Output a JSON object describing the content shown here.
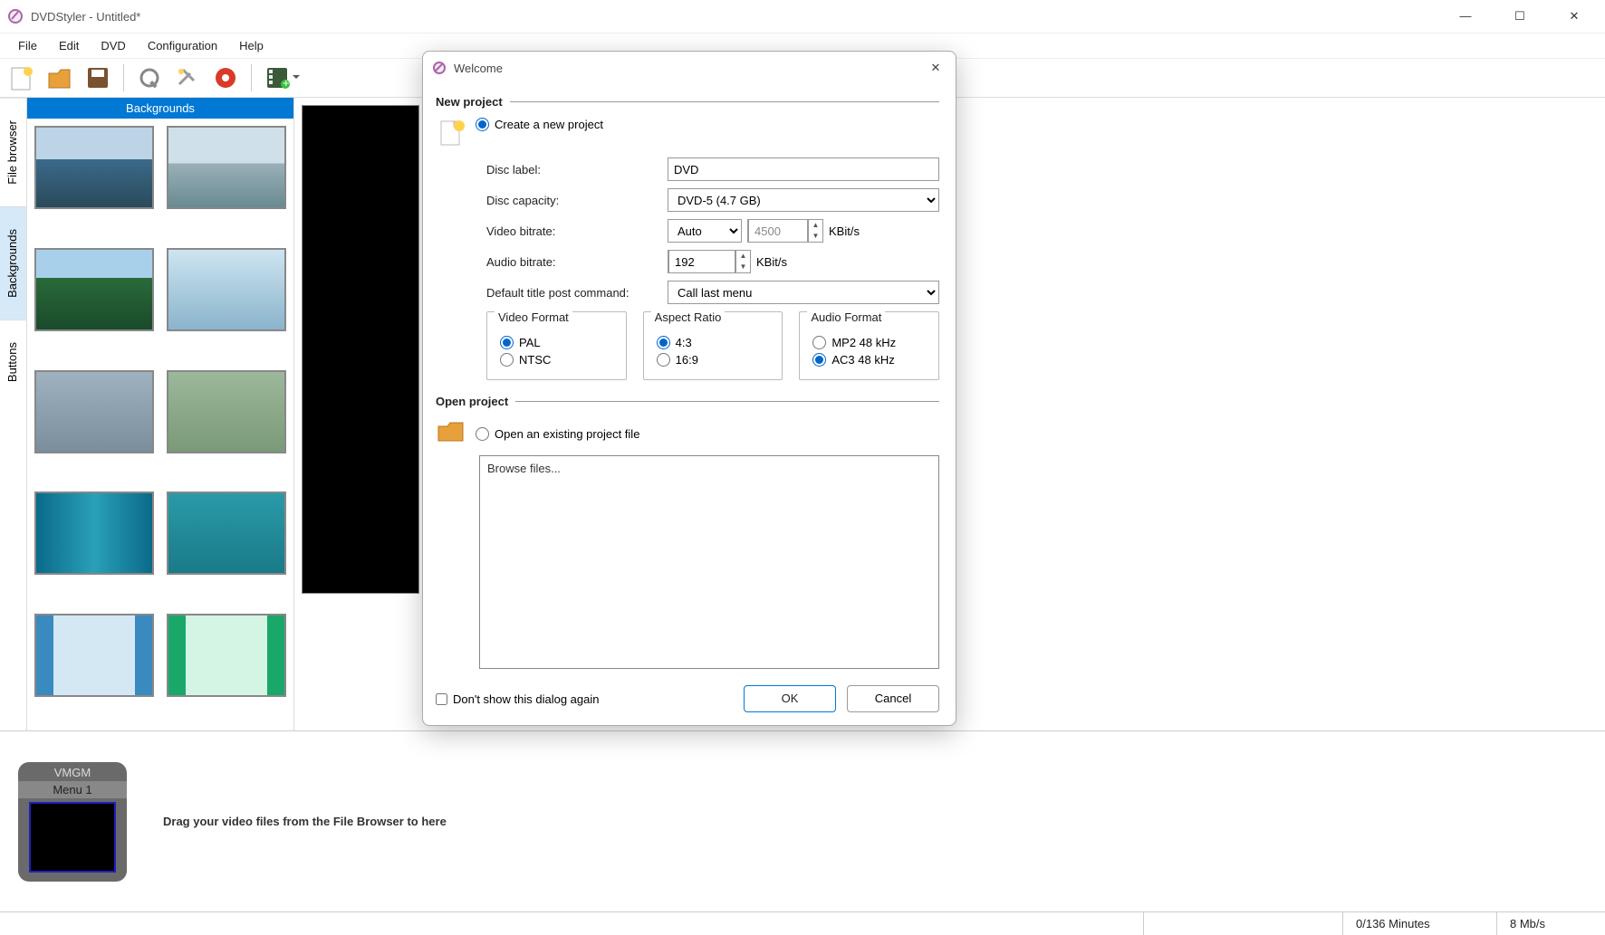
{
  "window": {
    "title": "DVDStyler - Untitled*"
  },
  "menu": {
    "items": [
      "File",
      "Edit",
      "DVD",
      "Configuration",
      "Help"
    ]
  },
  "sidebar": {
    "tabs": [
      "File browser",
      "Backgrounds",
      "Buttons"
    ],
    "active": 1
  },
  "panel": {
    "header": "Backgrounds"
  },
  "timeline": {
    "vmgm_label": "VMGM",
    "menu_label": "Menu 1",
    "hint": "Drag your video files from the File Browser to here"
  },
  "statusbar": {
    "minutes": "0/136 Minutes",
    "bitrate": "8 Mb/s"
  },
  "dialog": {
    "title": "Welcome",
    "new_project_heading": "New project",
    "create_label": "Create a new project",
    "disc_label_lab": "Disc label:",
    "disc_label_val": "DVD",
    "disc_capacity_lab": "Disc capacity:",
    "disc_capacity_val": "DVD-5 (4.7 GB)",
    "video_bitrate_lab": "Video bitrate:",
    "video_bitrate_mode": "Auto",
    "video_bitrate_val": "4500",
    "audio_bitrate_lab": "Audio bitrate:",
    "audio_bitrate_val": "192",
    "kbits": "KBit/s",
    "post_cmd_lab": "Default title post command:",
    "post_cmd_val": "Call last menu",
    "video_format_legend": "Video Format",
    "vf_pal": "PAL",
    "vf_ntsc": "NTSC",
    "aspect_legend": "Aspect Ratio",
    "ar_43": "4:3",
    "ar_169": "16:9",
    "audio_format_legend": "Audio Format",
    "af_mp2": "MP2 48 kHz",
    "af_ac3": "AC3 48 kHz",
    "open_project_heading": "Open project",
    "open_label": "Open an existing project file",
    "browse_text": "Browse files...",
    "dont_show": "Don't show this dialog again",
    "ok": "OK",
    "cancel": "Cancel"
  }
}
